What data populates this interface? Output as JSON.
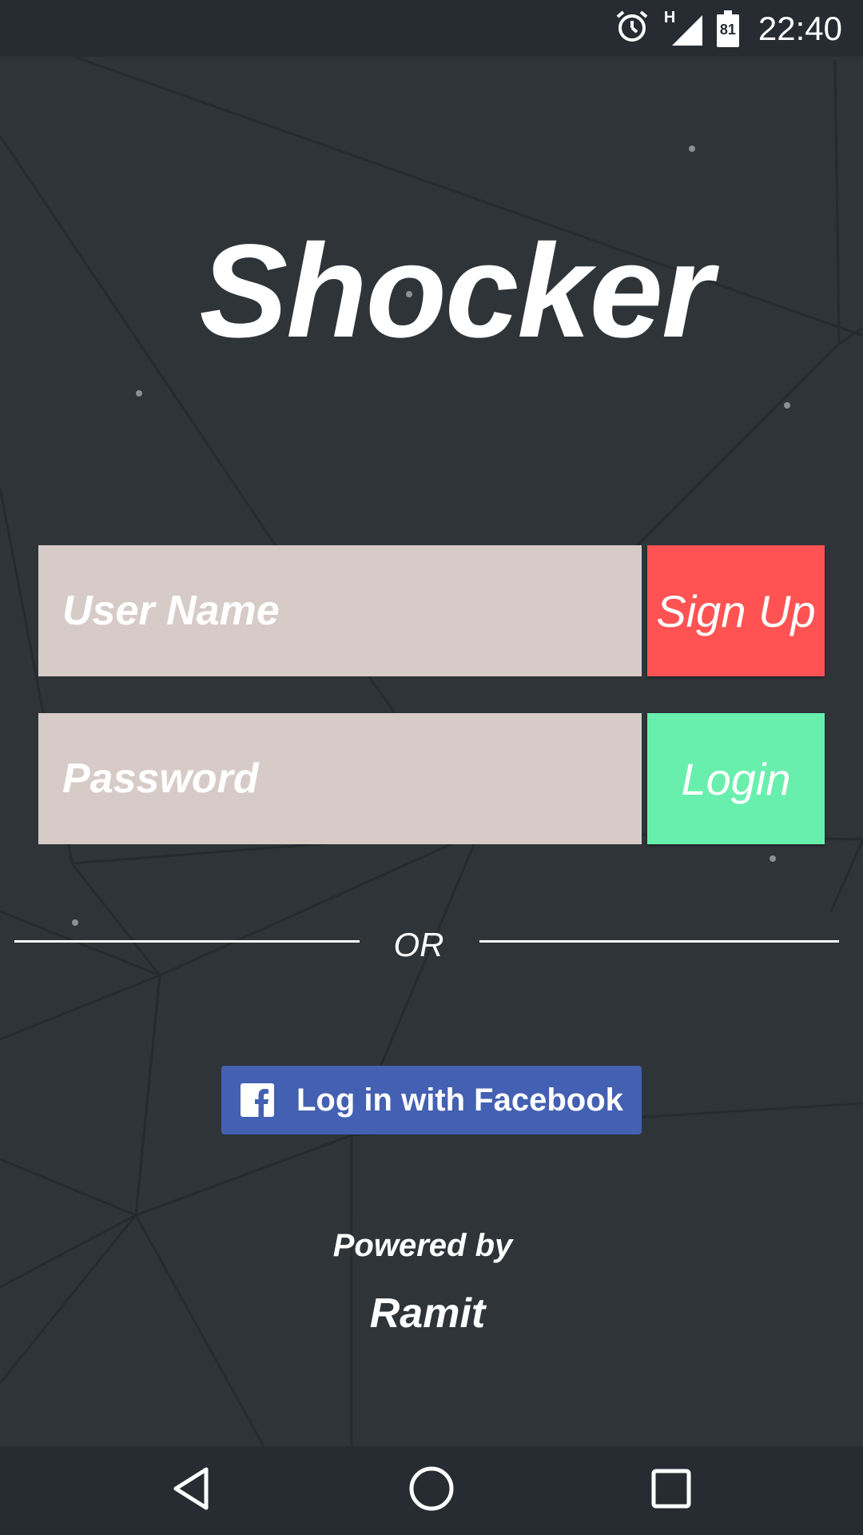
{
  "status_bar": {
    "time": "22:40",
    "battery_level": "81",
    "network_type": "H",
    "icons": [
      "alarm-icon",
      "signal-icon",
      "battery-icon"
    ]
  },
  "app": {
    "title": "Shocker"
  },
  "form": {
    "username_placeholder": "User Name",
    "password_placeholder": "Password",
    "signup_label": "Sign Up",
    "login_label": "Login"
  },
  "divider": {
    "label": "OR"
  },
  "facebook": {
    "label": "Log in with Facebook",
    "icon": "facebook-icon"
  },
  "footer": {
    "powered_label": "Powered by",
    "author": "Ramit"
  },
  "nav_bar": {
    "icons": [
      "back-icon",
      "home-icon",
      "recents-icon"
    ]
  },
  "colors": {
    "background": "#2f3439",
    "status_bar": "#262c32",
    "input": "#d7cbc8",
    "signup": "#ff5353",
    "login": "#69efad",
    "facebook": "#4460b2"
  }
}
